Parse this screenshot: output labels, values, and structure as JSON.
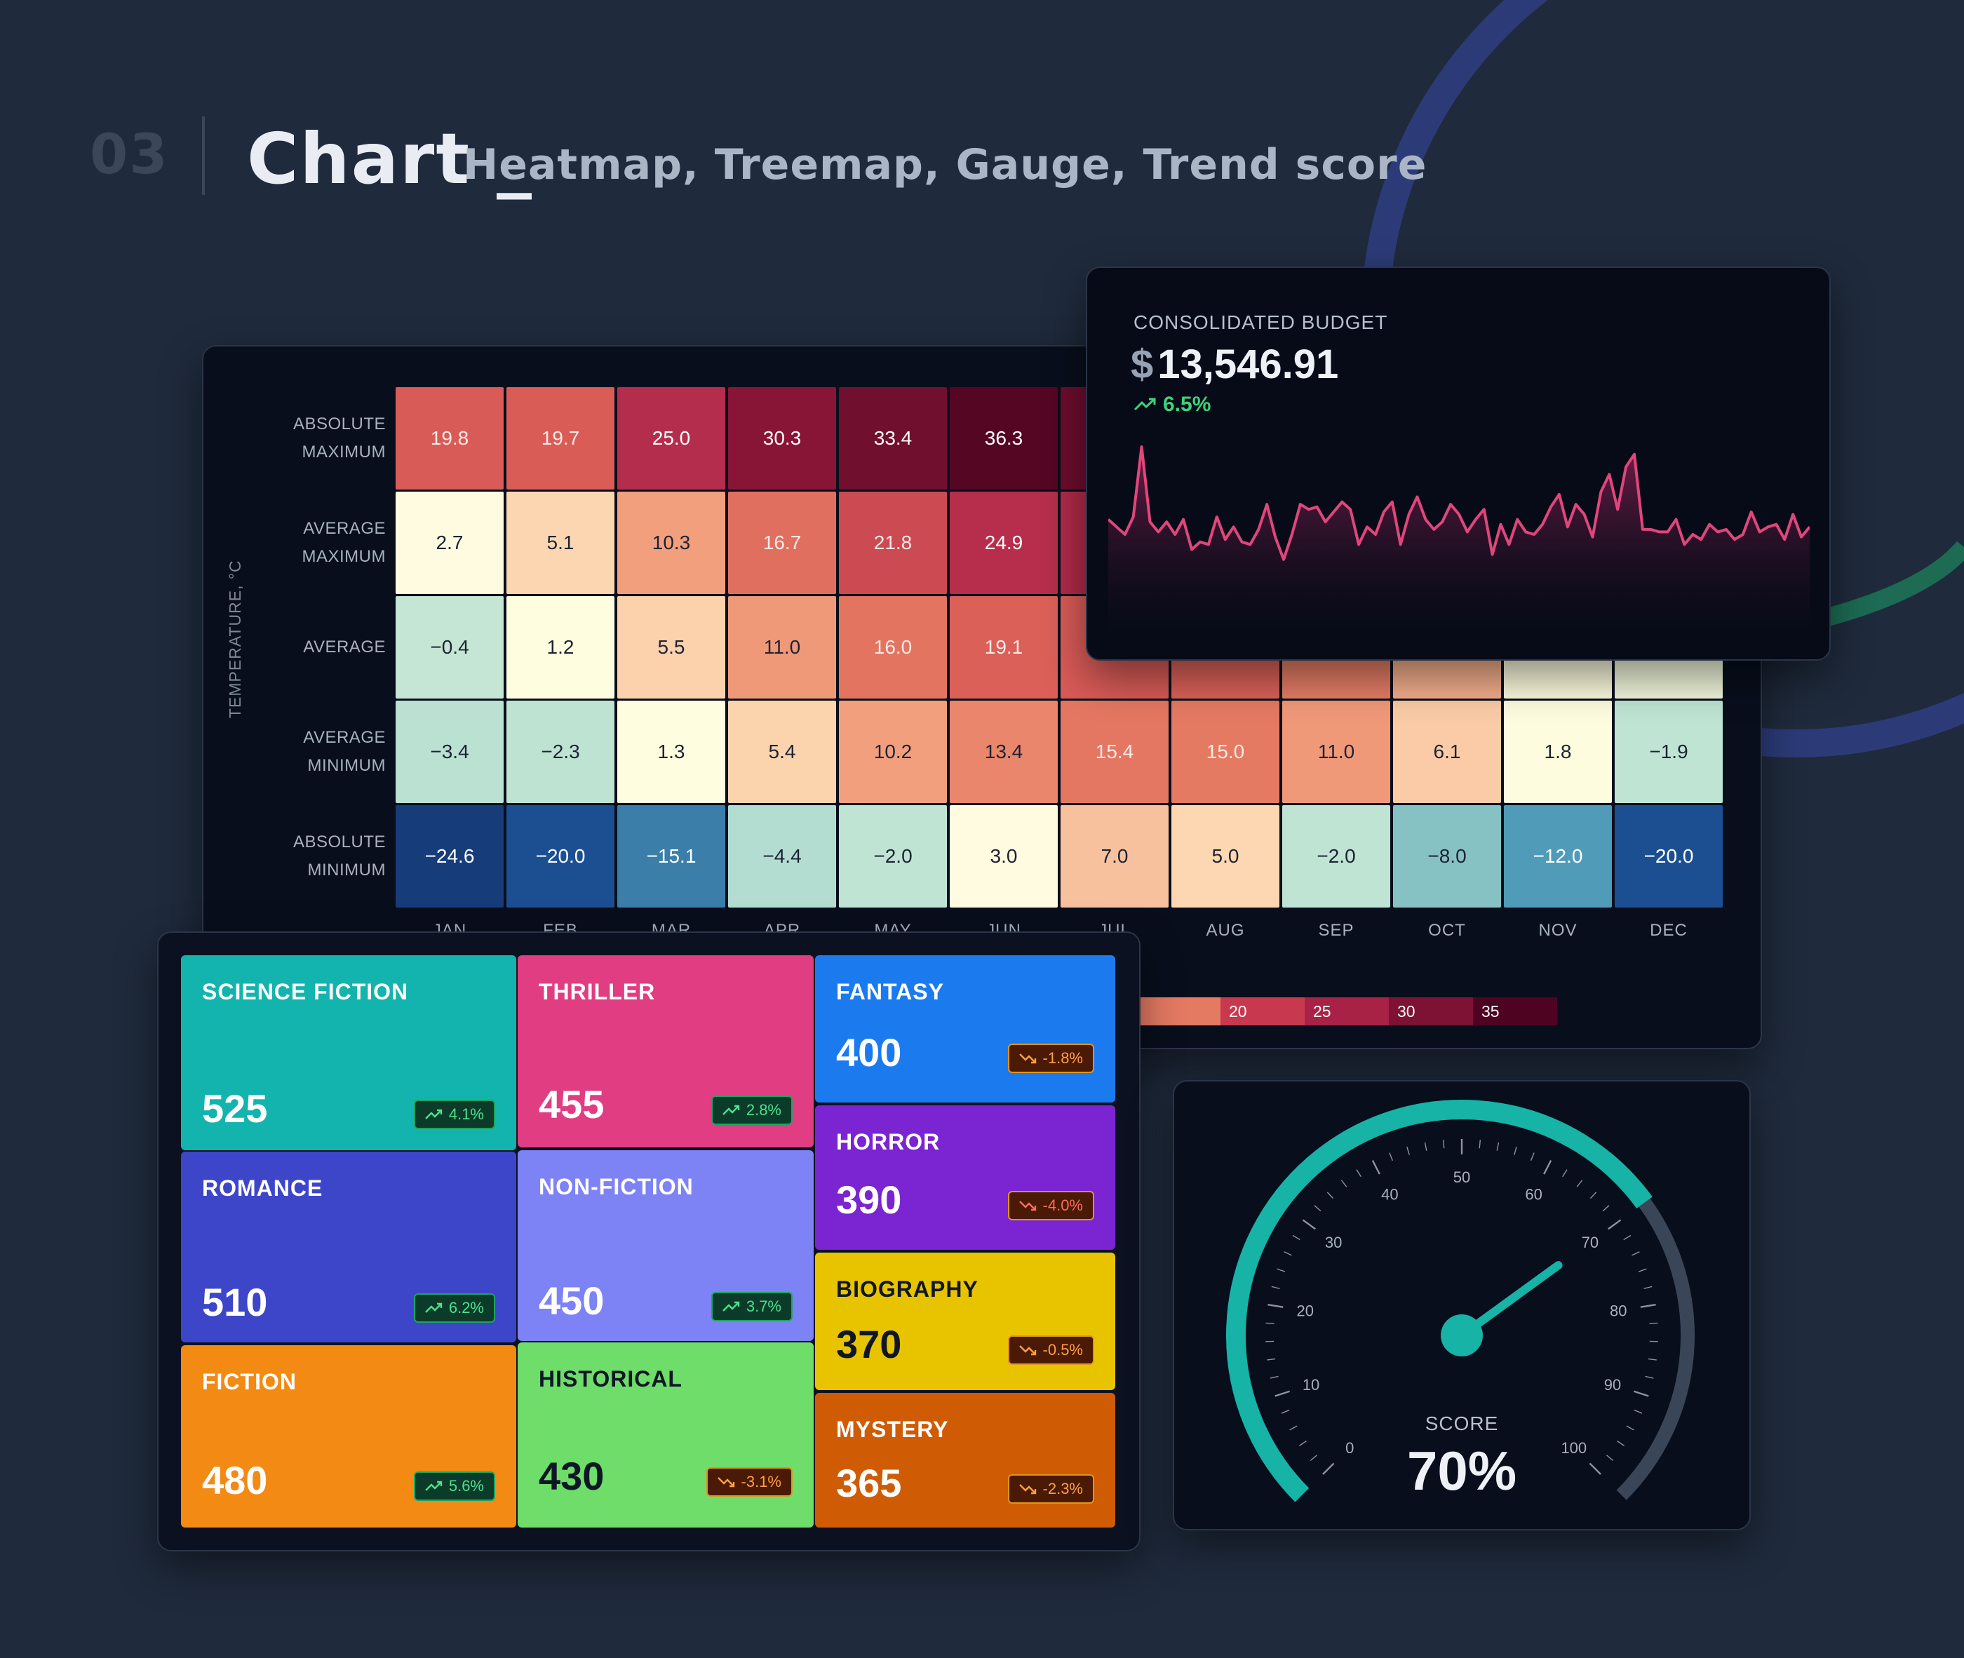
{
  "header": {
    "number": "03",
    "title": "Chart _",
    "subtitle": "Heatmap, Treemap, Gauge, Trend score"
  },
  "heatmap": {
    "axis_title": "TEMPERATURE, °C",
    "rows": [
      {
        "label_1": "ABSOLUTE",
        "label_2": "MAXIMUM"
      },
      {
        "label_1": "AVERAGE",
        "label_2": "MAXIMUM"
      },
      {
        "label_1": "AVERAGE",
        "label_2": ""
      },
      {
        "label_1": "AVERAGE",
        "label_2": "MINIMUM"
      },
      {
        "label_1": "ABSOLUTE",
        "label_2": "MINIMUM"
      }
    ],
    "months": [
      "JAN",
      "FEB",
      "MAR",
      "APR",
      "MAY",
      "JUN",
      "JUL",
      "AUG",
      "SEP",
      "OCT",
      "NOV",
      "DEC"
    ],
    "legend_ticks": [
      "20",
      "25",
      "30",
      "35"
    ]
  },
  "chart_data": [
    {
      "type": "heatmap",
      "x": [
        "JAN",
        "FEB",
        "MAR",
        "APR",
        "MAY",
        "JUN",
        "JUL",
        "AUG",
        "SEP",
        "OCT",
        "NOV",
        "DEC"
      ],
      "y": [
        "ABSOLUTE MAXIMUM",
        "AVERAGE MAXIMUM",
        "AVERAGE",
        "AVERAGE MINIMUM",
        "ABSOLUTE MINIMUM"
      ],
      "ylabel": "TEMPERATURE, °C",
      "values": [
        [
          "19.8",
          "19.7",
          "25.0",
          "30.3",
          "33.4",
          "36.3",
          null,
          null,
          null,
          null,
          null,
          null
        ],
        [
          "2.7",
          "5.1",
          "10.3",
          "16.7",
          "21.8",
          "24.9",
          null,
          null,
          null,
          null,
          null,
          null
        ],
        [
          "−0.4",
          "1.2",
          "5.5",
          "11.0",
          "16.0",
          "19.1",
          null,
          null,
          null,
          null,
          null,
          null
        ],
        [
          "−3.4",
          "−2.3",
          "1.3",
          "5.4",
          "10.2",
          "13.4",
          "15.4",
          "15.0",
          "11.0",
          "6.1",
          "1.8",
          "−1.9"
        ],
        [
          "−24.6",
          "−20.0",
          "−15.1",
          "−4.4",
          "−2.0",
          "3.0",
          "7.0",
          "5.0",
          "−2.0",
          "−8.0",
          "−12.0",
          "−20.0"
        ]
      ],
      "colorscale_ticks": [
        20,
        25,
        30,
        35
      ]
    },
    {
      "type": "area",
      "title": "CONSOLIDATED BUDGET",
      "currency": "$",
      "total": "13,546.91",
      "trend": "6.5%",
      "color": "#e0467c",
      "values": [
        34,
        31,
        28,
        35,
        63,
        33,
        29,
        33,
        28,
        34,
        22,
        25,
        24,
        35,
        26,
        31,
        25,
        24,
        30,
        40,
        27,
        18,
        28,
        40,
        38,
        39,
        33,
        37,
        41,
        38,
        24,
        31,
        28,
        37,
        41,
        24,
        36,
        43,
        34,
        30,
        33,
        40,
        36,
        29,
        34,
        38,
        20,
        32,
        24,
        34,
        29,
        28,
        32,
        39,
        44,
        31,
        40,
        36,
        27,
        45,
        52,
        38,
        55,
        60,
        30,
        30,
        29,
        29,
        34,
        24,
        28,
        26,
        32,
        29,
        30,
        26,
        28,
        37,
        29,
        31,
        32,
        26,
        36,
        27,
        31
      ]
    },
    {
      "type": "treemap",
      "items": [
        {
          "name": "SCIENCE FICTION",
          "value": 525,
          "change": "4.1%"
        },
        {
          "name": "ROMANCE",
          "value": 510,
          "change": "6.2%"
        },
        {
          "name": "FICTION",
          "value": 480,
          "change": "5.6%"
        },
        {
          "name": "THRILLER",
          "value": 455,
          "change": "2.8%"
        },
        {
          "name": "NON-FICTION",
          "value": 450,
          "change": "3.7%"
        },
        {
          "name": "HISTORICAL",
          "value": 430,
          "change": "-3.1%"
        },
        {
          "name": "FANTASY",
          "value": 400,
          "change": "-1.8%"
        },
        {
          "name": "HORROR",
          "value": 390,
          "change": "-4.0%"
        },
        {
          "name": "BIOGRAPHY",
          "value": 370,
          "change": "-0.5%"
        },
        {
          "name": "MYSTERY",
          "value": 365,
          "change": "-2.3%"
        }
      ]
    },
    {
      "type": "gauge",
      "label": "SCORE",
      "value": 70,
      "display": "70%",
      "min": 0,
      "max": 100,
      "tick_labels": [
        "0",
        "10",
        "20",
        "30",
        "40",
        "50",
        "60",
        "70",
        "80",
        "90",
        "100"
      ],
      "fill_color": "#17b3a6",
      "track_color": "#3a4658"
    }
  ],
  "budget": {
    "label": "CONSOLIDATED BUDGET",
    "currency": "$",
    "value": "13,546.91",
    "trend": "6.5%"
  },
  "treemap": {
    "tiles": [
      {
        "name": "SCIENCE FICTION",
        "value": "525",
        "change": "4.1%",
        "dir": "up",
        "color": "#13b4ad",
        "text": "#ffffff"
      },
      {
        "name": "ROMANCE",
        "value": "510",
        "change": "6.2%",
        "dir": "up",
        "color": "#3d46c9",
        "text": "#ffffff"
      },
      {
        "name": "FICTION",
        "value": "480",
        "change": "5.6%",
        "dir": "up",
        "color": "#f38a14",
        "text": "#ffffff"
      },
      {
        "name": "THRILLER",
        "value": "455",
        "change": "2.8%",
        "dir": "up",
        "color": "#e03d82",
        "text": "#ffffff"
      },
      {
        "name": "NON-FICTION",
        "value": "450",
        "change": "3.7%",
        "dir": "up",
        "color": "#7d82f5",
        "text": "#ffffff"
      },
      {
        "name": "HISTORICAL",
        "value": "430",
        "change": "-3.1%",
        "dir": "down",
        "color": "#6fdd69",
        "text": "#0f1726"
      },
      {
        "name": "FANTASY",
        "value": "400",
        "change": "-1.8%",
        "dir": "down",
        "color": "#1b7bee",
        "text": "#ffffff"
      },
      {
        "name": "HORROR",
        "value": "390",
        "change": "-4.0%",
        "dir": "down",
        "color": "#7b24d2",
        "text": "#ffffff"
      },
      {
        "name": "BIOGRAPHY",
        "value": "370",
        "change": "-0.5%",
        "dir": "down",
        "color": "#e8c400",
        "text": "#0f1726"
      },
      {
        "name": "MYSTERY",
        "value": "365",
        "change": "-2.3%",
        "dir": "down",
        "color": "#cf5c05",
        "text": "#ffffff"
      }
    ]
  },
  "gauge": {
    "label": "SCORE",
    "display": "70%"
  }
}
